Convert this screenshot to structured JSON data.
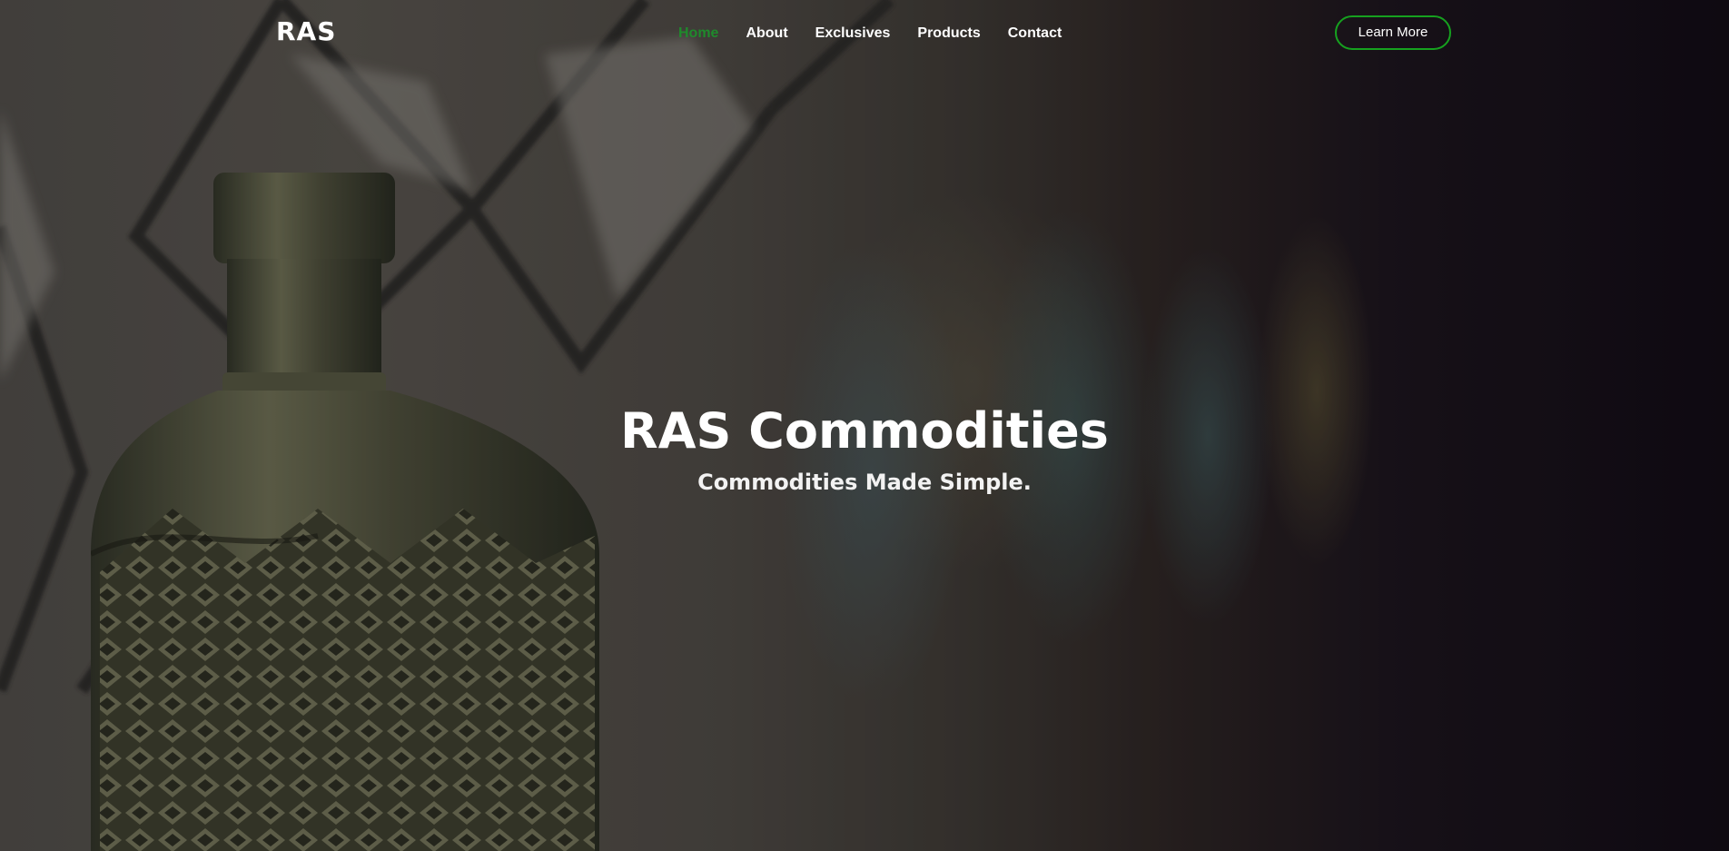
{
  "brand": {
    "logo_text": "RAS"
  },
  "nav": {
    "items": [
      {
        "label": "Home",
        "active": true
      },
      {
        "label": "About",
        "active": false
      },
      {
        "label": "Exclusives",
        "active": false
      },
      {
        "label": "Products",
        "active": false
      },
      {
        "label": "Contact",
        "active": false
      }
    ],
    "cta_label": "Learn More"
  },
  "hero": {
    "title": "RAS Commodities",
    "subtitle": "Commodities Made Simple.",
    "background_image": "glass-bottles-photo"
  },
  "colors": {
    "accent": "#16a11f",
    "active_nav": "#1f8a2c",
    "text": "#ffffff"
  }
}
